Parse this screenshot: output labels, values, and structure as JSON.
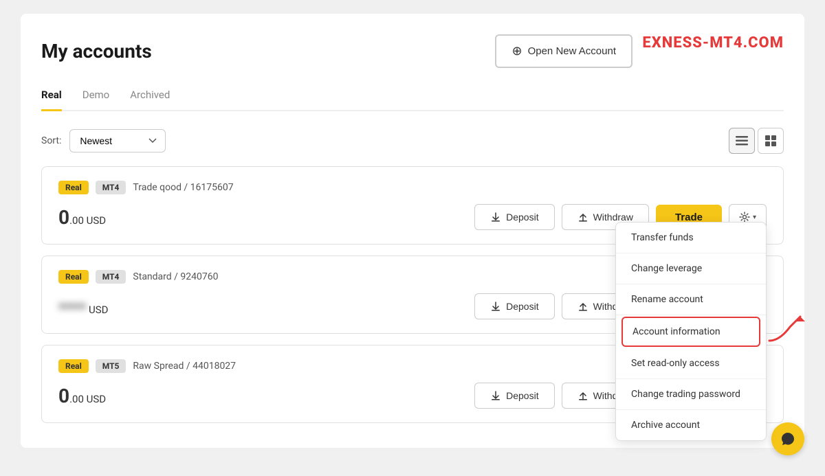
{
  "page": {
    "title": "My accounts",
    "branding": "EXNESS-MT4.COM",
    "open_account_btn": "Open New Account"
  },
  "tabs": [
    {
      "label": "Real",
      "active": true
    },
    {
      "label": "Demo",
      "active": false
    },
    {
      "label": "Archived",
      "active": false
    }
  ],
  "sort": {
    "label": "Sort:",
    "value": "Newest"
  },
  "accounts": [
    {
      "type": "Real",
      "platform": "MT4",
      "name": "Trade qood / 16175607",
      "balance": "0",
      "decimals": ".00",
      "currency": "USD",
      "blurred": false
    },
    {
      "type": "Real",
      "platform": "MT4",
      "name": "Standard / 9240760",
      "balance": "****",
      "decimals": "",
      "currency": "USD",
      "blurred": true
    },
    {
      "type": "Real",
      "platform": "MT5",
      "name": "Raw Spread / 44018027",
      "balance": "0",
      "decimals": ".00",
      "currency": "USD",
      "blurred": false
    }
  ],
  "buttons": {
    "deposit": "Deposit",
    "withdraw": "Withdraw",
    "trade": "Trade"
  },
  "dropdown": {
    "items": [
      {
        "label": "Transfer funds",
        "highlighted": false
      },
      {
        "label": "Change leverage",
        "highlighted": false
      },
      {
        "label": "Rename account",
        "highlighted": false
      },
      {
        "label": "Account information",
        "highlighted": true
      },
      {
        "label": "Set read-only access",
        "highlighted": false
      },
      {
        "label": "Change trading password",
        "highlighted": false
      },
      {
        "label": "Archive account",
        "highlighted": false
      }
    ]
  }
}
